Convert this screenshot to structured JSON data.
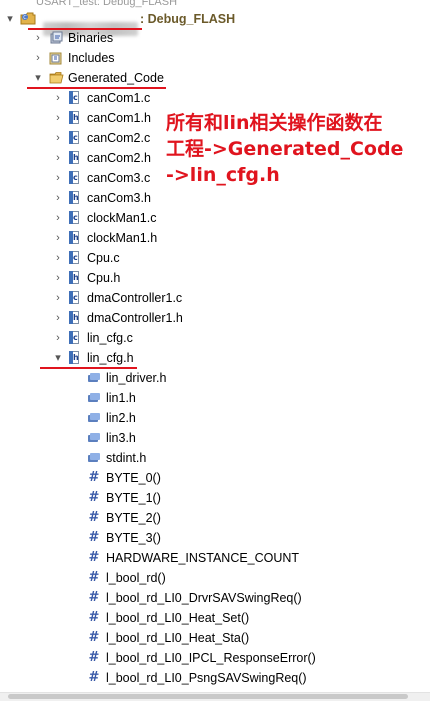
{
  "top_item": {
    "label": "USART_test: Debug_FLASH"
  },
  "project": {
    "config_label": ": Debug_FLASH"
  },
  "folders": [
    {
      "label": "Binaries"
    },
    {
      "label": "Includes"
    },
    {
      "label": "Generated_Code"
    }
  ],
  "files": [
    {
      "name": "canCom1.c",
      "type": "c"
    },
    {
      "name": "canCom1.h",
      "type": "h"
    },
    {
      "name": "canCom2.c",
      "type": "c"
    },
    {
      "name": "canCom2.h",
      "type": "h"
    },
    {
      "name": "canCom3.c",
      "type": "c"
    },
    {
      "name": "canCom3.h",
      "type": "h"
    },
    {
      "name": "clockMan1.c",
      "type": "c"
    },
    {
      "name": "clockMan1.h",
      "type": "h"
    },
    {
      "name": "Cpu.c",
      "type": "c"
    },
    {
      "name": "Cpu.h",
      "type": "h"
    },
    {
      "name": "dmaController1.c",
      "type": "c"
    },
    {
      "name": "dmaController1.h",
      "type": "h"
    },
    {
      "name": "lin_cfg.c",
      "type": "c"
    },
    {
      "name": "lin_cfg.h",
      "type": "h"
    }
  ],
  "includes": [
    {
      "name": "lin_driver.h"
    },
    {
      "name": "lin1.h"
    },
    {
      "name": "lin2.h"
    },
    {
      "name": "lin3.h"
    },
    {
      "name": "stdint.h"
    }
  ],
  "defines": [
    {
      "name": "BYTE_0()"
    },
    {
      "name": "BYTE_1()"
    },
    {
      "name": "BYTE_2()"
    },
    {
      "name": "BYTE_3()"
    },
    {
      "name": "HARDWARE_INSTANCE_COUNT"
    },
    {
      "name": "l_bool_rd()"
    },
    {
      "name": "l_bool_rd_LI0_DrvrSAVSwingReq()"
    },
    {
      "name": "l_bool_rd_LI0_Heat_Set()"
    },
    {
      "name": "l_bool_rd_LI0_Heat_Sta()"
    },
    {
      "name": "l_bool_rd_LI0_IPCL_ResponseError()"
    },
    {
      "name": "l_bool_rd_LI0_PsngSAVSwingReq()"
    }
  ],
  "annotation": {
    "line1": "所有和lin相关操作函数在",
    "line2": "工程->Generated_Code",
    "line3": "->lin_cfg.h"
  },
  "colors": {
    "annotation": "#e0141e",
    "underline": "#e0141e"
  }
}
